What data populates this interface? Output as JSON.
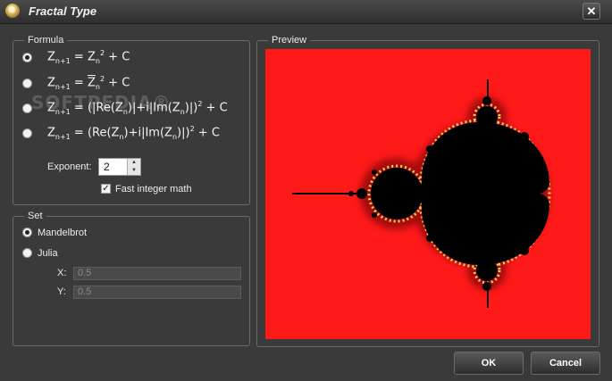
{
  "window": {
    "title": "Fractal Type",
    "close_glyph": "✕"
  },
  "formula_group": {
    "label": "Formula",
    "options": [
      {
        "selected": true
      },
      {
        "selected": false
      },
      {
        "selected": false
      },
      {
        "selected": false
      }
    ],
    "exponent_label": "Exponent:",
    "exponent_value": "2",
    "fast_integer_label": "Fast integer math",
    "fast_integer_checked": true
  },
  "set_group": {
    "label": "Set",
    "mandelbrot_label": "Mandelbrot",
    "julia_label": "Julia",
    "selected": "Mandelbrot",
    "x_label": "X:",
    "x_value": "0.5",
    "y_label": "Y:",
    "y_value": "0.5"
  },
  "preview": {
    "label": "Preview",
    "background_color": "#ff1a1a",
    "fractal_color": "#000000",
    "edge_color": "#f0d060"
  },
  "buttons": {
    "ok": "OK",
    "cancel": "Cancel"
  },
  "watermark": "SOFTPEDIA®",
  "icons": {
    "app": "shell-icon",
    "close": "close-icon",
    "spin": "spin-arrows-icon",
    "check": "checkmark-icon"
  }
}
